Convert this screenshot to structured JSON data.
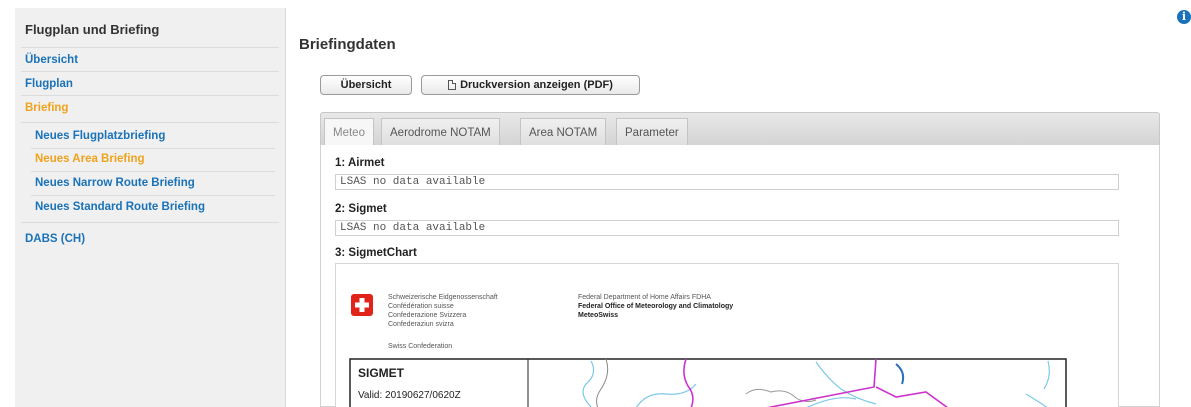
{
  "sidebar": {
    "title": "Flugplan und Briefing",
    "items": [
      {
        "label": "Übersicht"
      },
      {
        "label": "Flugplan"
      },
      {
        "label": "Briefing"
      },
      {
        "label": "Neues Flugplatzbriefing"
      },
      {
        "label": "Neues Area Briefing"
      },
      {
        "label": "Neues Narrow Route Briefing"
      },
      {
        "label": "Neues Standard Route Briefing"
      },
      {
        "label": "DABS (CH)"
      }
    ]
  },
  "main": {
    "title": "Briefingdaten",
    "buttons": {
      "overview": "Übersicht",
      "print": "Druckversion anzeigen (PDF)"
    },
    "tabs": [
      {
        "label": "Meteo"
      },
      {
        "label": "Aerodrome NOTAM"
      },
      {
        "label": "Area NOTAM"
      },
      {
        "label": "Parameter"
      }
    ],
    "sections": [
      {
        "heading": "1: Airmet",
        "text": "LSAS no data available"
      },
      {
        "heading": "2: Sigmet",
        "text": "LSAS no data available"
      },
      {
        "heading": "3: SigmetChart"
      }
    ]
  },
  "sigmet_chart": {
    "header_left": [
      "Schweizerische Eidgenossenschaft",
      "Confédération suisse",
      "Confederazione Svizzera",
      "Confederaziun svizra"
    ],
    "swiss_confederation": "Swiss Confederation",
    "header_right": [
      "Federal Department of Home Affairs FDHA",
      "Federal Office of Meteorology and Climatology",
      "MeteoSwiss"
    ],
    "box_title": "SIGMET",
    "valid": "Valid:  20190627/0620Z"
  },
  "colors": {
    "link": "#1a72b8",
    "active": "#f1a21b",
    "sigmet_area": "#cc33cc",
    "rivers": "#7ec8e8",
    "swiss_red": "#e2231a"
  },
  "icons": {
    "info": "info-icon",
    "pdf": "document-icon",
    "flag": "swiss-cross-icon"
  },
  "info_glyph": "i"
}
